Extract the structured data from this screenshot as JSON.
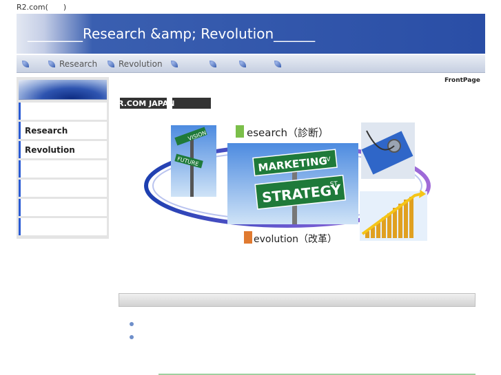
{
  "page": {
    "top_text": "R2.com(　　)"
  },
  "banner": {
    "title": "________Research &amp; Revolution______"
  },
  "nav": {
    "items": [
      {
        "label": ""
      },
      {
        "label": "Research"
      },
      {
        "label": "Revolution"
      },
      {
        "label": ""
      },
      {
        "label": ""
      },
      {
        "label": ""
      },
      {
        "label": ""
      }
    ]
  },
  "sidebar": {
    "items": [
      {
        "label": ""
      },
      {
        "label": "Research"
      },
      {
        "label": "Revolution"
      },
      {
        "label": ""
      },
      {
        "label": ""
      },
      {
        "label": ""
      },
      {
        "label": ""
      }
    ]
  },
  "content": {
    "frontpage_label": "FrontPage",
    "logo_text": "RR.COM JAPAN",
    "hero": {
      "research_text": "esearch（診断）",
      "revolution_text": "evolution（改革）",
      "sign_vision": "VISION",
      "sign_future": "FUTURE",
      "sign_marketing": "MARKETING",
      "sign_av": "AV",
      "sign_strategy": "STRATEGY",
      "sign_st": "ST"
    }
  },
  "colors": {
    "accent": "#2a5bd4",
    "banner": "#2a4ea6"
  }
}
